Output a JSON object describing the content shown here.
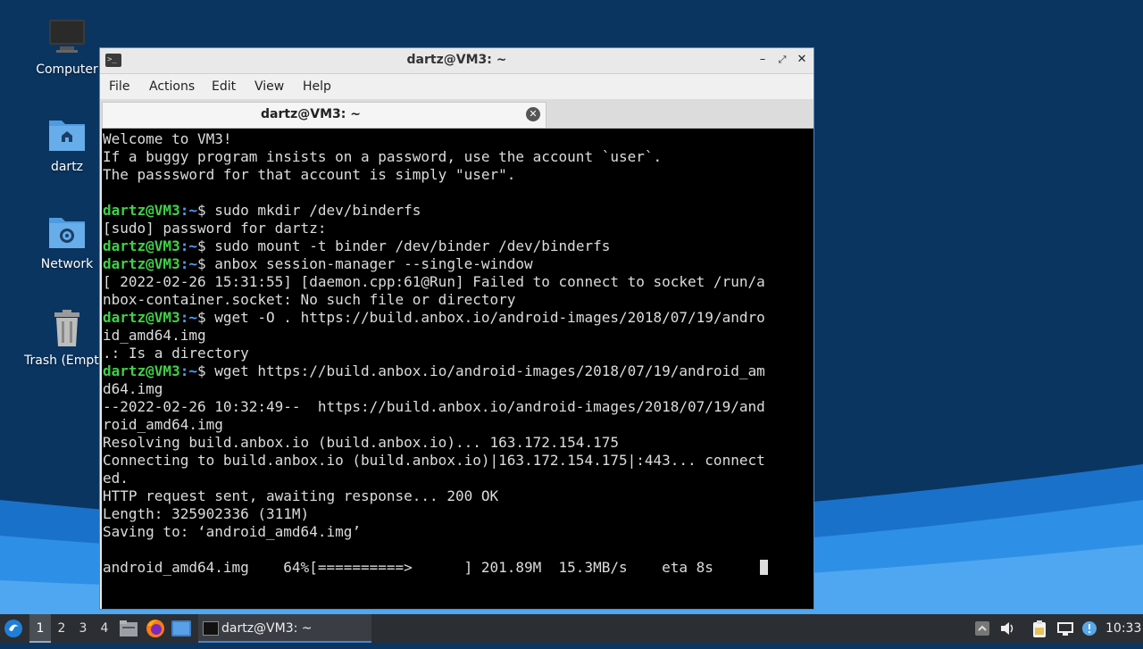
{
  "desktop": {
    "icons": [
      {
        "label": "Computer"
      },
      {
        "label": "dartz"
      },
      {
        "label": "Network"
      },
      {
        "label": "Trash (Empty)"
      }
    ]
  },
  "window": {
    "title": "dartz@VM3: ~",
    "menu": [
      "File",
      "Actions",
      "Edit",
      "View",
      "Help"
    ],
    "tab_title": "dartz@VM3: ~"
  },
  "terminal": {
    "prompt_user": "dartz@VM3",
    "prompt_dir": ":~",
    "lines": [
      {
        "text": "Welcome to VM3!"
      },
      {
        "text": "If a buggy program insists on a password, use the account `user`."
      },
      {
        "text": "The passsword for that account is simply \"user\"."
      },
      {
        "text": ""
      },
      {
        "prompt": true,
        "text": "$ sudo mkdir /dev/binderfs"
      },
      {
        "text": "[sudo] password for dartz:"
      },
      {
        "prompt": true,
        "text": "$ sudo mount -t binder /dev/binder /dev/binderfs"
      },
      {
        "prompt": true,
        "text": "$ anbox session-manager --single-window"
      },
      {
        "text": "[ 2022-02-26 15:31:55] [daemon.cpp:61@Run] Failed to connect to socket /run/a"
      },
      {
        "text": "nbox-container.socket: No such file or directory"
      },
      {
        "prompt": true,
        "text": "$ wget -O . https://build.anbox.io/android-images/2018/07/19/andro"
      },
      {
        "text": "id_amd64.img"
      },
      {
        "text": ".: Is a directory"
      },
      {
        "prompt": true,
        "text": "$ wget https://build.anbox.io/android-images/2018/07/19/android_am"
      },
      {
        "text": "d64.img"
      },
      {
        "text": "--2022-02-26 10:32:49--  https://build.anbox.io/android-images/2018/07/19/and"
      },
      {
        "text": "roid_amd64.img"
      },
      {
        "text": "Resolving build.anbox.io (build.anbox.io)... 163.172.154.175"
      },
      {
        "text": "Connecting to build.anbox.io (build.anbox.io)|163.172.154.175|:443... connect"
      },
      {
        "text": "ed."
      },
      {
        "text": "HTTP request sent, awaiting response... 200 OK"
      },
      {
        "text": "Length: 325902336 (311M)"
      },
      {
        "text": "Saving to: ‘android_amd64.img’"
      },
      {
        "text": ""
      },
      {
        "text": "android_amd64.img    64%[==========>      ] 201.89M  15.3MB/s    eta 8s",
        "cursor": true
      }
    ]
  },
  "taskbar": {
    "workspaces": [
      "1",
      "2",
      "3",
      "4"
    ],
    "active_workspace": "1",
    "task_label": "dartz@VM3: ~",
    "clock": "10:33"
  },
  "colors": {
    "prompt_green": "#40d048",
    "prompt_blue": "#4aa0ff",
    "terminal_bg": "#000000",
    "taskbar_bg": "#2b2e33"
  }
}
